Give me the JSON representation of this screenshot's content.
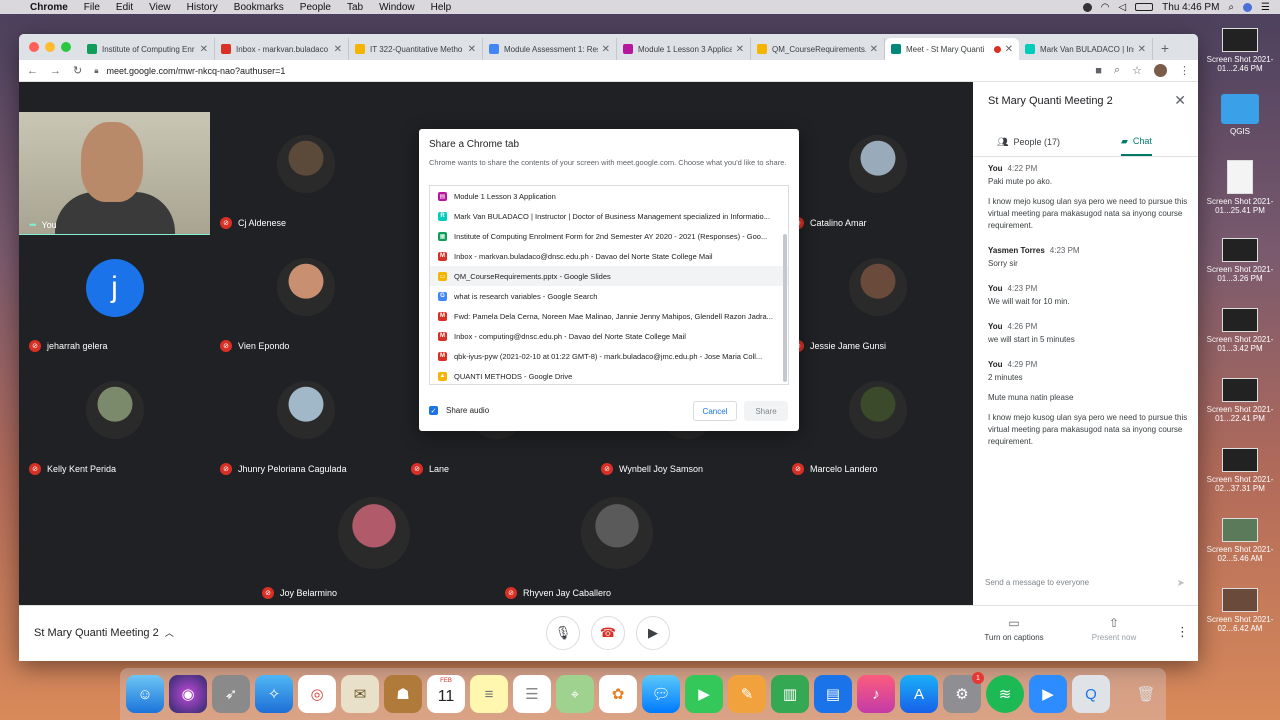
{
  "menubar": {
    "app": "Chrome",
    "items": [
      "File",
      "Edit",
      "View",
      "History",
      "Bookmarks",
      "People",
      "Tab",
      "Window",
      "Help"
    ],
    "clock": "Thu 4:46 PM"
  },
  "desktop": [
    {
      "label": "Screen Shot 2021-01...2.46 PM"
    },
    {
      "label": "QGIS"
    },
    {
      "label": "Screen Shot 2021-01...25.41 PM"
    },
    {
      "label": "Screen Shot 2021-01...3.26 PM"
    },
    {
      "label": "Screen Shot 2021-01...3.42 PM"
    },
    {
      "label": "Screen Shot 2021-01...22.41 PM"
    },
    {
      "label": "Screen Shot 2021-02...37.31 PM"
    },
    {
      "label": "Screen Shot 2021-02...5.46 AM"
    },
    {
      "label": "Screen Shot 2021-02...6.42 AM"
    }
  ],
  "tabs": [
    {
      "title": "Institute of Computing Enr",
      "fav": "sheets",
      "color": "#0f9d58"
    },
    {
      "title": "Inbox - markvan.buladaco",
      "fav": "gmail",
      "color": "#d93025"
    },
    {
      "title": "IT 322-Quantitative Metho",
      "fav": "drive",
      "color": "#f4b400"
    },
    {
      "title": "Module Assessment 1: Res",
      "fav": "loading",
      "color": "#4285f4"
    },
    {
      "title": "Module 1 Lesson 3 Applica",
      "fav": "classroom",
      "color": "#b5179e"
    },
    {
      "title": "QM_CourseRequirements.p",
      "fav": "slides",
      "color": "#f4b400"
    },
    {
      "title": "Meet - St Mary Quanti",
      "fav": "meet",
      "color": "#00897b",
      "active": true
    },
    {
      "title": "Mark Van BULADACO | Ins",
      "fav": "researchgate",
      "color": "#00ccbb"
    }
  ],
  "omnibox": {
    "url": "meet.google.com/mwr-nkcq-nao?authuser=1"
  },
  "participants": [
    {
      "name": "You",
      "self": true
    },
    {
      "name": "Cj Aldenese",
      "color": "#5b4a3a"
    },
    {
      "name": "Catalino Amar",
      "color": "#9ab"
    },
    {
      "name": "jeharrah gelera",
      "letter": "j",
      "color": "#1a73e8"
    },
    {
      "name": "Vien Epondo",
      "color": "#c89070"
    },
    {
      "name": "Jessie Jame Gunsi",
      "color": "#6a4a3a"
    },
    {
      "name": "Kelly Kent Perida",
      "color": "#7a8a6a"
    },
    {
      "name": "Jhunry Peloriana Cagulada",
      "color": "#a0b8c8"
    },
    {
      "name": "Lane",
      "color": "#e8e0d8"
    },
    {
      "name": "Wynbell Joy Samson",
      "color": "#8a7a6a"
    },
    {
      "name": "Marcelo Landero",
      "color": "#3a4a2a"
    },
    {
      "name": "Joy Belarmino",
      "color": "#b05a6a"
    },
    {
      "name": "Rhyven Jay Caballero",
      "color": "#5a5a5a"
    }
  ],
  "dialog": {
    "title": "Share a Chrome tab",
    "description": "Chrome wants to share the contents of your screen with meet.google.com. Choose what you'd like to share.",
    "items": [
      {
        "title": "Module 1 Lesson 3 Application",
        "fav": "classroom",
        "color": "#b5179e",
        "glyph": "▤"
      },
      {
        "title": "Mark Van BULADACO | Instructor | Doctor of Business Management specialized in Informatio...",
        "fav": "researchgate",
        "color": "#00ccbb",
        "glyph": "R"
      },
      {
        "title": "Institute of Computing Enrolment Form for 2nd Semester AY 2020 - 2021 (Responses) - Goo...",
        "fav": "sheets",
        "color": "#0f9d58",
        "glyph": "▦"
      },
      {
        "title": "Inbox - markvan.buladaco@dnsc.edu.ph - Davao del Norte State College Mail",
        "fav": "gmail",
        "color": "#d93025",
        "glyph": "M"
      },
      {
        "title": "QM_CourseRequirements.pptx - Google Slides",
        "fav": "slides",
        "color": "#f4b400",
        "glyph": "▭"
      },
      {
        "title": "what is research variables - Google Search",
        "fav": "google",
        "color": "#4285f4",
        "glyph": "G"
      },
      {
        "title": "Fwd: Pamela Dela Cerna, Noreen Mae Malinao, Jannie Jenny Mahipos, Glendell Razon Jadra...",
        "fav": "gmail",
        "color": "#d93025",
        "glyph": "M"
      },
      {
        "title": "Inbox - computing@dnsc.edu.ph - Davao del Norte State College Mail",
        "fav": "gmail",
        "color": "#d93025",
        "glyph": "M"
      },
      {
        "title": "qbk-iyus-pyw (2021-02-10 at 01:22 GMT-8) - mark.buladaco@jmc.edu.ph - Jose Maria Coll...",
        "fav": "gmail",
        "color": "#d93025",
        "glyph": "M"
      },
      {
        "title": "QUANTI METHODS - Google Drive",
        "fav": "drive",
        "color": "#f4b400",
        "glyph": "▲"
      }
    ],
    "share_audio": "Share audio",
    "cancel": "Cancel",
    "share": "Share"
  },
  "panel": {
    "title": "St Mary Quanti Meeting 2",
    "people_tab": "People (17)",
    "chat_tab": "Chat",
    "messages": [
      {
        "sender": "You",
        "time": "4:22 PM",
        "lines": [
          "Paki mute po ako.",
          "I know mejo kusog ulan sya pero we need to pursue this virtual meeting para makasugod nata sa inyong course requirement."
        ]
      },
      {
        "sender": "Yasmen Torres",
        "time": "4:23 PM",
        "lines": [
          "Sorry sir"
        ]
      },
      {
        "sender": "You",
        "time": "4:23 PM",
        "lines": [
          "We will wait for 10 min."
        ]
      },
      {
        "sender": "You",
        "time": "4:26 PM",
        "lines": [
          "we will start in 5 minutes"
        ]
      },
      {
        "sender": "You",
        "time": "4:29 PM",
        "lines": [
          "2 minutes",
          "Mute muna natin please",
          "I know mejo kusog ulan sya pero we need to pursue this virtual meeting para makasugod nata sa inyong course requirement."
        ]
      }
    ],
    "input_placeholder": "Send a message to everyone"
  },
  "bottombar": {
    "meeting_title": "St Mary Quanti Meeting 2",
    "captions": "Turn on captions",
    "present": "Present now"
  },
  "dock": {
    "calendar_month": "FEB",
    "calendar_day": "11",
    "settings_badge": "1"
  }
}
